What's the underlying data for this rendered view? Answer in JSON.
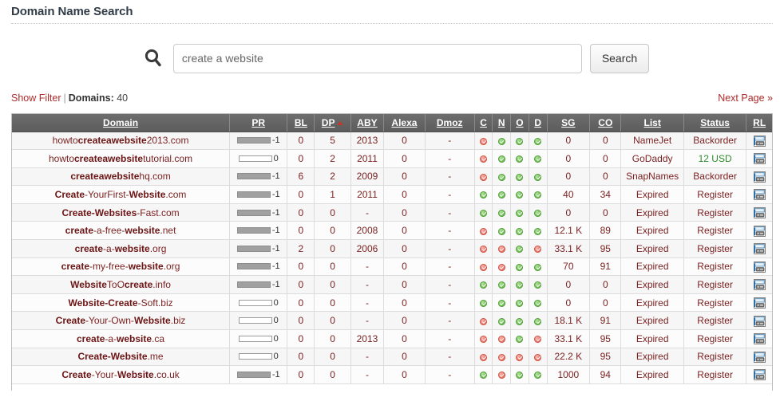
{
  "page": {
    "title": "Domain Name Search"
  },
  "search": {
    "icon": "search-icon",
    "value": "create a website",
    "placeholder": "create a website",
    "button_label": "Search"
  },
  "filterbar": {
    "show_filter_label": "Show Filter",
    "separator": "|",
    "domains_label": "Domains:",
    "domains_count": "40",
    "next_page_label": "Next Page »"
  },
  "table": {
    "columns": [
      {
        "key": "domain",
        "label": "Domain",
        "sorted": false
      },
      {
        "key": "pr",
        "label": "PR",
        "sorted": false
      },
      {
        "key": "bl",
        "label": "BL",
        "sorted": false
      },
      {
        "key": "dp",
        "label": "DP",
        "sorted": true
      },
      {
        "key": "aby",
        "label": "ABY",
        "sorted": false
      },
      {
        "key": "alexa",
        "label": "Alexa",
        "sorted": false
      },
      {
        "key": "dmoz",
        "label": "Dmoz",
        "sorted": false
      },
      {
        "key": "c",
        "label": "C",
        "sorted": false
      },
      {
        "key": "n",
        "label": "N",
        "sorted": false
      },
      {
        "key": "o",
        "label": "O",
        "sorted": false
      },
      {
        "key": "d",
        "label": "D",
        "sorted": false
      },
      {
        "key": "sg",
        "label": "SG",
        "sorted": false
      },
      {
        "key": "co",
        "label": "CO",
        "sorted": false
      },
      {
        "key": "list",
        "label": "List",
        "sorted": false
      },
      {
        "key": "status",
        "label": "Status",
        "sorted": false
      },
      {
        "key": "rl",
        "label": "RL",
        "sorted": false
      }
    ],
    "sort_arrow": "triangle-up-icon",
    "rl_icon": "screenshot-preview-icon",
    "rows": [
      {
        "domain_parts": [
          {
            "t": "howto",
            "b": false
          },
          {
            "t": "createawebsite",
            "b": true
          },
          {
            "t": "2013.com",
            "b": false
          }
        ],
        "pr_filled": true,
        "pr_value": "-1",
        "bl": "0",
        "dp": "5",
        "aby": "2013",
        "alexa": "0",
        "dmoz": "-",
        "c": "red",
        "n": "green",
        "o": "green",
        "d": "green",
        "sg": "0",
        "co": "0",
        "list": "NameJet",
        "status": "Backorder",
        "status_kind": "text"
      },
      {
        "domain_parts": [
          {
            "t": "howto",
            "b": false
          },
          {
            "t": "createawebsite",
            "b": true
          },
          {
            "t": "tutorial.com",
            "b": false
          }
        ],
        "pr_filled": false,
        "pr_value": "0",
        "bl": "0",
        "dp": "2",
        "aby": "2011",
        "alexa": "0",
        "dmoz": "-",
        "c": "red",
        "n": "green",
        "o": "green",
        "d": "green",
        "sg": "0",
        "co": "0",
        "list": "GoDaddy",
        "status": "12 USD",
        "status_kind": "price"
      },
      {
        "domain_parts": [
          {
            "t": "createawebsite",
            "b": true
          },
          {
            "t": "hq.com",
            "b": false
          }
        ],
        "pr_filled": true,
        "pr_value": "-1",
        "bl": "6",
        "dp": "2",
        "aby": "2009",
        "alexa": "0",
        "dmoz": "-",
        "c": "red",
        "n": "green",
        "o": "green",
        "d": "green",
        "sg": "0",
        "co": "0",
        "list": "SnapNames",
        "status": "Backorder",
        "status_kind": "text"
      },
      {
        "domain_parts": [
          {
            "t": "Create",
            "b": true
          },
          {
            "t": "-YourFirst-",
            "b": false
          },
          {
            "t": "Website",
            "b": true
          },
          {
            "t": ".com",
            "b": false
          }
        ],
        "pr_filled": true,
        "pr_value": "-1",
        "bl": "0",
        "dp": "1",
        "aby": "2011",
        "alexa": "0",
        "dmoz": "-",
        "c": "green",
        "n": "green",
        "o": "green",
        "d": "green",
        "sg": "40",
        "co": "34",
        "list": "Expired",
        "status": "Register",
        "status_kind": "text"
      },
      {
        "domain_parts": [
          {
            "t": "Create-Websites",
            "b": true
          },
          {
            "t": "-Fast.com",
            "b": false
          }
        ],
        "pr_filled": true,
        "pr_value": "-1",
        "bl": "0",
        "dp": "0",
        "aby": "-",
        "alexa": "0",
        "dmoz": "-",
        "c": "green",
        "n": "green",
        "o": "green",
        "d": "green",
        "sg": "0",
        "co": "0",
        "list": "Expired",
        "status": "Register",
        "status_kind": "text"
      },
      {
        "domain_parts": [
          {
            "t": "create",
            "b": true
          },
          {
            "t": "-a-free-",
            "b": false
          },
          {
            "t": "website",
            "b": true
          },
          {
            "t": ".net",
            "b": false
          }
        ],
        "pr_filled": true,
        "pr_value": "-1",
        "bl": "0",
        "dp": "0",
        "aby": "2008",
        "alexa": "0",
        "dmoz": "-",
        "c": "red",
        "n": "green",
        "o": "green",
        "d": "green",
        "sg": "12.1 K",
        "co": "89",
        "list": "Expired",
        "status": "Register",
        "status_kind": "text"
      },
      {
        "domain_parts": [
          {
            "t": "create",
            "b": true
          },
          {
            "t": "-a-",
            "b": false
          },
          {
            "t": "website",
            "b": true
          },
          {
            "t": ".org",
            "b": false
          }
        ],
        "pr_filled": true,
        "pr_value": "-1",
        "bl": "2",
        "dp": "0",
        "aby": "2006",
        "alexa": "0",
        "dmoz": "-",
        "c": "red",
        "n": "red",
        "o": "green",
        "d": "red",
        "sg": "33.1 K",
        "co": "95",
        "list": "Expired",
        "status": "Register",
        "status_kind": "text"
      },
      {
        "domain_parts": [
          {
            "t": "create",
            "b": true
          },
          {
            "t": "-my-free-",
            "b": false
          },
          {
            "t": "website",
            "b": true
          },
          {
            "t": ".org",
            "b": false
          }
        ],
        "pr_filled": true,
        "pr_value": "-1",
        "bl": "0",
        "dp": "0",
        "aby": "-",
        "alexa": "0",
        "dmoz": "-",
        "c": "red",
        "n": "red",
        "o": "green",
        "d": "green",
        "sg": "70",
        "co": "91",
        "list": "Expired",
        "status": "Register",
        "status_kind": "text"
      },
      {
        "domain_parts": [
          {
            "t": "Website",
            "b": true
          },
          {
            "t": "ToO",
            "b": false
          },
          {
            "t": "create",
            "b": true
          },
          {
            "t": ".info",
            "b": false
          }
        ],
        "pr_filled": true,
        "pr_value": "-1",
        "bl": "0",
        "dp": "0",
        "aby": "-",
        "alexa": "0",
        "dmoz": "-",
        "c": "green",
        "n": "green",
        "o": "green",
        "d": "green",
        "sg": "0",
        "co": "0",
        "list": "Expired",
        "status": "Register",
        "status_kind": "text"
      },
      {
        "domain_parts": [
          {
            "t": "Website-Create",
            "b": true
          },
          {
            "t": "-Soft.biz",
            "b": false
          }
        ],
        "pr_filled": false,
        "pr_value": "0",
        "bl": "0",
        "dp": "0",
        "aby": "-",
        "alexa": "0",
        "dmoz": "-",
        "c": "green",
        "n": "green",
        "o": "green",
        "d": "green",
        "sg": "0",
        "co": "0",
        "list": "Expired",
        "status": "Register",
        "status_kind": "text"
      },
      {
        "domain_parts": [
          {
            "t": "Create",
            "b": true
          },
          {
            "t": "-Your-Own-",
            "b": false
          },
          {
            "t": "Website",
            "b": true
          },
          {
            "t": ".biz",
            "b": false
          }
        ],
        "pr_filled": false,
        "pr_value": "0",
        "bl": "0",
        "dp": "0",
        "aby": "-",
        "alexa": "0",
        "dmoz": "-",
        "c": "red",
        "n": "green",
        "o": "green",
        "d": "green",
        "sg": "18.1 K",
        "co": "91",
        "list": "Expired",
        "status": "Register",
        "status_kind": "text"
      },
      {
        "domain_parts": [
          {
            "t": "create",
            "b": true
          },
          {
            "t": "-a-",
            "b": false
          },
          {
            "t": "website",
            "b": true
          },
          {
            "t": ".ca",
            "b": false
          }
        ],
        "pr_filled": false,
        "pr_value": "0",
        "bl": "0",
        "dp": "0",
        "aby": "2013",
        "alexa": "0",
        "dmoz": "-",
        "c": "red",
        "n": "red",
        "o": "green",
        "d": "red",
        "sg": "33.1 K",
        "co": "95",
        "list": "Expired",
        "status": "Register",
        "status_kind": "text"
      },
      {
        "domain_parts": [
          {
            "t": "Create-Website",
            "b": true
          },
          {
            "t": ".me",
            "b": false
          }
        ],
        "pr_filled": false,
        "pr_value": "0",
        "bl": "0",
        "dp": "0",
        "aby": "-",
        "alexa": "0",
        "dmoz": "-",
        "c": "red",
        "n": "red",
        "o": "red",
        "d": "red",
        "sg": "22.2 K",
        "co": "95",
        "list": "Expired",
        "status": "Register",
        "status_kind": "text"
      },
      {
        "domain_parts": [
          {
            "t": "Create",
            "b": true
          },
          {
            "t": "-Your-",
            "b": false
          },
          {
            "t": "Website",
            "b": true
          },
          {
            "t": ".co.uk",
            "b": false
          }
        ],
        "pr_filled": true,
        "pr_value": "-1",
        "bl": "0",
        "dp": "0",
        "aby": "-",
        "alexa": "0",
        "dmoz": "-",
        "c": "green",
        "n": "red",
        "o": "green",
        "d": "green",
        "sg": "1000",
        "co": "94",
        "list": "Expired",
        "status": "Register",
        "status_kind": "text"
      }
    ]
  }
}
